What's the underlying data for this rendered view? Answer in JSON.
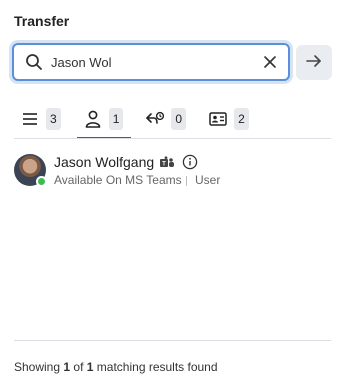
{
  "panel": {
    "title": "Transfer"
  },
  "search": {
    "value": "Jason Wol",
    "placeholder": ""
  },
  "tabs": [
    {
      "icon": "list-icon",
      "count": "3"
    },
    {
      "icon": "person-icon",
      "count": "1"
    },
    {
      "icon": "recent-transfer-icon",
      "count": "0"
    },
    {
      "icon": "contact-card-icon",
      "count": "2"
    }
  ],
  "results": [
    {
      "name": "Jason Wolfgang",
      "status": "Available On MS Teams",
      "role": "User",
      "presence_color": "#3fb950"
    }
  ],
  "footer": {
    "prefix": "Showing",
    "shown": "1",
    "of": "of",
    "total": "1",
    "suffix": "matching results found"
  },
  "colors": {
    "accent": "#2b5fb3",
    "focus_ring": "#5b8fd9"
  }
}
